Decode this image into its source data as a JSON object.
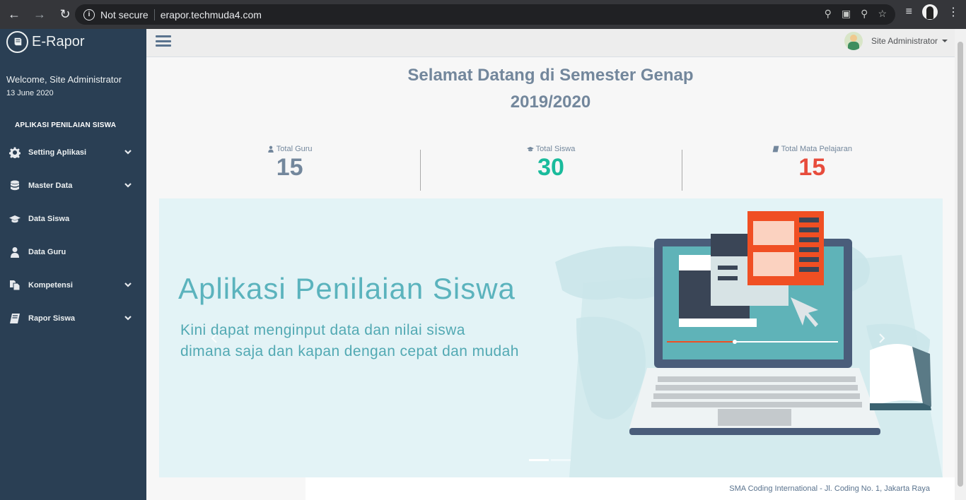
{
  "browser": {
    "security_label": "Not secure",
    "url": "erapor.techmuda4.com"
  },
  "sidebar": {
    "brand": "E-Rapor",
    "welcome": "Welcome, Site Administrator",
    "date": "13 June 2020",
    "section_title": "APLIKASI PENILAIAN SISWA",
    "items": [
      {
        "label": "Setting Aplikasi",
        "icon": "gear-icon",
        "has_submenu": true
      },
      {
        "label": "Master Data",
        "icon": "database-icon",
        "has_submenu": true
      },
      {
        "label": "Data Siswa",
        "icon": "graduation-cap-icon",
        "has_submenu": false
      },
      {
        "label": "Data Guru",
        "icon": "user-icon",
        "has_submenu": false
      },
      {
        "label": "Kompetensi",
        "icon": "files-icon",
        "has_submenu": true
      },
      {
        "label": "Rapor Siswa",
        "icon": "book-icon",
        "has_submenu": true
      }
    ]
  },
  "topnav": {
    "user_name": "Site Administrator"
  },
  "main": {
    "title_line1": "Selamat Datang di Semester Genap",
    "title_line2": "2019/2020",
    "stats": [
      {
        "label": "Total Guru",
        "value": "15",
        "color": "#73879c",
        "icon": "user-icon"
      },
      {
        "label": "Total Siswa",
        "value": "30",
        "color": "#1abb9c",
        "icon": "graduation-cap-icon"
      },
      {
        "label": "Total Mata Pelajaran",
        "value": "15",
        "color": "#e74c3c",
        "icon": "book-icon"
      }
    ],
    "banner": {
      "title": "Aplikasi Penilaian Siswa",
      "subtitle_line1": "Kini dapat menginput data dan nilai siswa",
      "subtitle_line2": "dimana saja dan kapan dengan cepat dan mudah"
    }
  },
  "footer": {
    "text": "SMA Coding International - Jl. Coding No. 1, Jakarta Raya"
  },
  "colors": {
    "sidebar_bg": "#2a3f54",
    "heading": "#73879c",
    "accent_green": "#1abb9c",
    "accent_red": "#e74c3c"
  }
}
